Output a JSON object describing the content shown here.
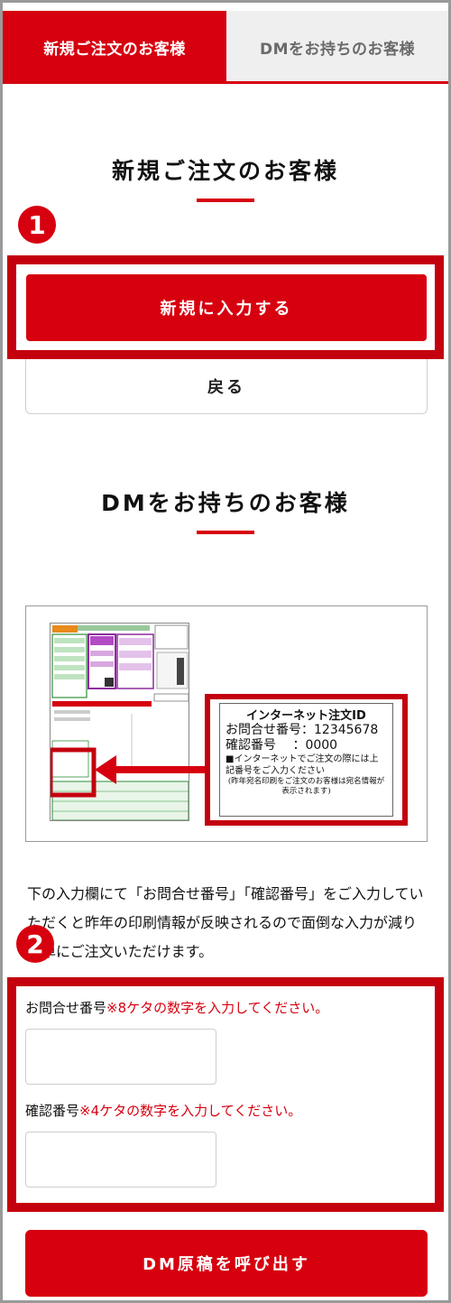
{
  "tabs": {
    "new_customer": "新規ご注文のお客様",
    "dm_customer": "DMをお持ちのお客様"
  },
  "section_new": {
    "title": "新規ご注文のお客様",
    "step_number": "1",
    "enter_button": "新規に入力する",
    "back_button": "戻る"
  },
  "section_dm": {
    "title": "DMをお持ちのお客様",
    "image": {
      "info_title": "インターネット注文ID",
      "inquiry_row": "お問合せ番号：12345678",
      "confirm_row": "確認番号　 ：0000",
      "note1": "■インターネットでご注文の際には上記番号をご入力ください",
      "note2": "(昨年宛名印刷をご注文のお客様は宛名情報が表示されます)"
    },
    "description": "下の入力欄にて「お問合せ番号」「確認番号」をご入力していただくと昨年の印刷情報が反映されるので面倒な入力が減り簡単にご注文いただけます。",
    "step_number": "2",
    "inquiry_label": "お問合せ番号",
    "inquiry_note": "※8ケタの数字を入力してください。",
    "inquiry_value": "",
    "confirm_label": "確認番号",
    "confirm_note": "※4ケタの数字を入力してください。",
    "confirm_value": "",
    "call_button": "DM原稿を呼び出す"
  },
  "colors": {
    "accent": "#d7000f",
    "highlight": "#c4000e",
    "tab_inactive_bg": "#efefef"
  }
}
